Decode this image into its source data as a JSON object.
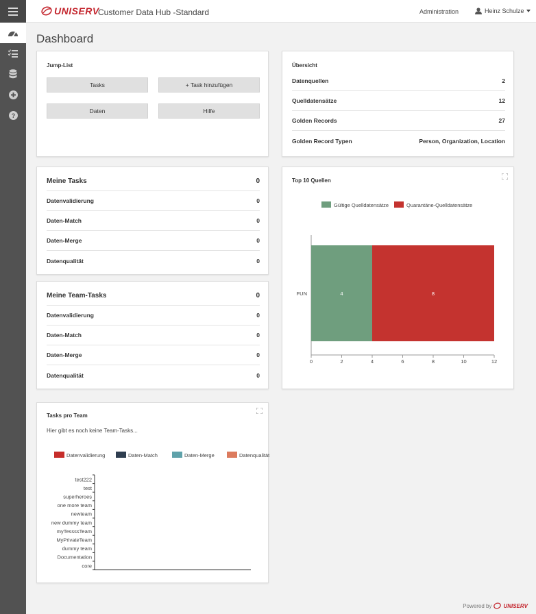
{
  "header": {
    "brand": "UNISERV",
    "app_title": "Customer Data Hub -Standard",
    "admin_link": "Administration",
    "user_name": "Heinz Schulze"
  },
  "page_title": "Dashboard",
  "jump_list": {
    "title": "Jump-List",
    "buttons": [
      "Tasks",
      "+ Task hinzufügen",
      "Daten",
      "Hilfe"
    ]
  },
  "overview": {
    "title": "Übersicht",
    "rows": [
      {
        "label": "Datenquellen",
        "value": "2"
      },
      {
        "label": "Quelldatensätze",
        "value": "12"
      },
      {
        "label": "Golden Records",
        "value": "27"
      },
      {
        "label": "Golden Record Typen",
        "value": "Person, Organization, Location"
      }
    ]
  },
  "my_tasks": {
    "title": "Meine Tasks",
    "total": "0",
    "rows": [
      {
        "label": "Datenvalidierung",
        "value": "0"
      },
      {
        "label": "Daten-Match",
        "value": "0"
      },
      {
        "label": "Daten-Merge",
        "value": "0"
      },
      {
        "label": "Datenqualität",
        "value": "0"
      }
    ]
  },
  "team_tasks": {
    "title": "Meine Team-Tasks",
    "total": "0",
    "rows": [
      {
        "label": "Datenvalidierung",
        "value": "0"
      },
      {
        "label": "Daten-Match",
        "value": "0"
      },
      {
        "label": "Daten-Merge",
        "value": "0"
      },
      {
        "label": "Datenqualität",
        "value": "0"
      }
    ]
  },
  "tasks_per_team": {
    "title": "Tasks pro Team",
    "empty_message": "Hier gibt es noch keine Team-Tasks..."
  },
  "top_sources": {
    "title": "Top 10 Quellen"
  },
  "footer": {
    "powered_by": "Powered by",
    "brand": "UNISERV"
  },
  "colors": {
    "accent": "#c4272f",
    "valid": "#6f9e7e",
    "quarantine": "#c4332f",
    "validation": "#c62d2a",
    "match": "#2f3e50",
    "merge": "#5fa2aa",
    "quality": "#dc7b5e"
  },
  "chart_data": [
    {
      "type": "bar",
      "orientation": "horizontal",
      "stacked": true,
      "title": "Top 10 Quellen",
      "categories": [
        "FUN"
      ],
      "series": [
        {
          "name": "Gültige Quelldatensätze",
          "values": [
            4
          ],
          "color": "#6f9e7e"
        },
        {
          "name": "Quarantäne-Quelldatensätze",
          "values": [
            8
          ],
          "color": "#c4332f"
        }
      ],
      "xlim": [
        0,
        12
      ],
      "xticks": [
        "0",
        "2",
        "4",
        "6",
        "8",
        "10",
        "12"
      ],
      "legend": "top"
    },
    {
      "type": "bar",
      "orientation": "horizontal",
      "stacked": true,
      "title": "Tasks pro Team",
      "categories": [
        "test222",
        "test",
        "superheroes",
        "one more team",
        "newteam",
        "new dummy team",
        "myTessssTeam",
        "MyPrivateTeam",
        "dummy team",
        "Documentation",
        "core"
      ],
      "series": [
        {
          "name": "Datenvalidierung",
          "values": [
            0,
            0,
            0,
            0,
            0,
            0,
            0,
            0,
            0,
            0,
            0
          ],
          "color": "#c62d2a"
        },
        {
          "name": "Daten-Match",
          "values": [
            0,
            0,
            0,
            0,
            0,
            0,
            0,
            0,
            0,
            0,
            0
          ],
          "color": "#2f3e50"
        },
        {
          "name": "Daten-Merge",
          "values": [
            0,
            0,
            0,
            0,
            0,
            0,
            0,
            0,
            0,
            0,
            0
          ],
          "color": "#5fa2aa"
        },
        {
          "name": "Datenqualität",
          "values": [
            0,
            0,
            0,
            0,
            0,
            0,
            0,
            0,
            0,
            0,
            0
          ],
          "color": "#dc7b5e"
        }
      ],
      "legend": "top"
    }
  ]
}
